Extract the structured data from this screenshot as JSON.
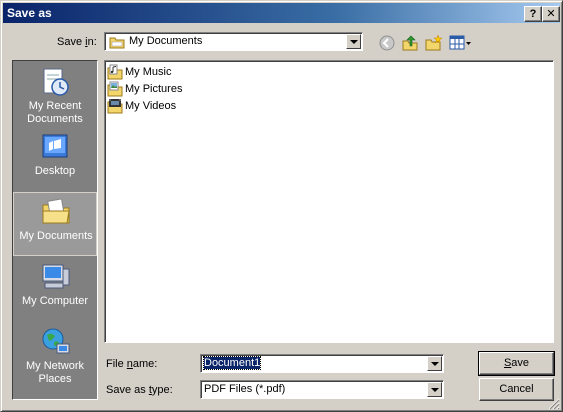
{
  "window": {
    "title": "Save as",
    "help_label": "?",
    "close_label": "✕"
  },
  "save_in": {
    "label_pre": "Save ",
    "label_accel": "i",
    "label_post": "n:",
    "value": "My Documents"
  },
  "toolbar": {
    "back": "back-icon",
    "up": "up-folder-icon",
    "new_folder": "new-folder-icon",
    "views": "views-menu-icon"
  },
  "places": [
    {
      "label_line1": "My Recent",
      "label_line2": "Documents",
      "icon": "recent-documents-icon"
    },
    {
      "label_line1": "Desktop",
      "label_line2": "",
      "icon": "desktop-icon"
    },
    {
      "label_line1": "My Documents",
      "label_line2": "",
      "icon": "my-documents-icon"
    },
    {
      "label_line1": "My Computer",
      "label_line2": "",
      "icon": "my-computer-icon"
    },
    {
      "label_line1": "My Network",
      "label_line2": "Places",
      "icon": "network-places-icon"
    }
  ],
  "files": [
    {
      "name": "My Music",
      "icon": "music-folder-icon"
    },
    {
      "name": "My Pictures",
      "icon": "pictures-folder-icon"
    },
    {
      "name": "My Videos",
      "icon": "videos-folder-icon"
    }
  ],
  "file_name": {
    "label_pre": "File ",
    "label_accel": "n",
    "label_post": "ame:",
    "value": "Document1"
  },
  "save_type": {
    "label_pre": "Save as ",
    "label_accel": "t",
    "label_post": "ype:",
    "value": "PDF Files (*.pdf)"
  },
  "buttons": {
    "save_accel": "S",
    "save_rest": "ave",
    "cancel": "Cancel"
  }
}
